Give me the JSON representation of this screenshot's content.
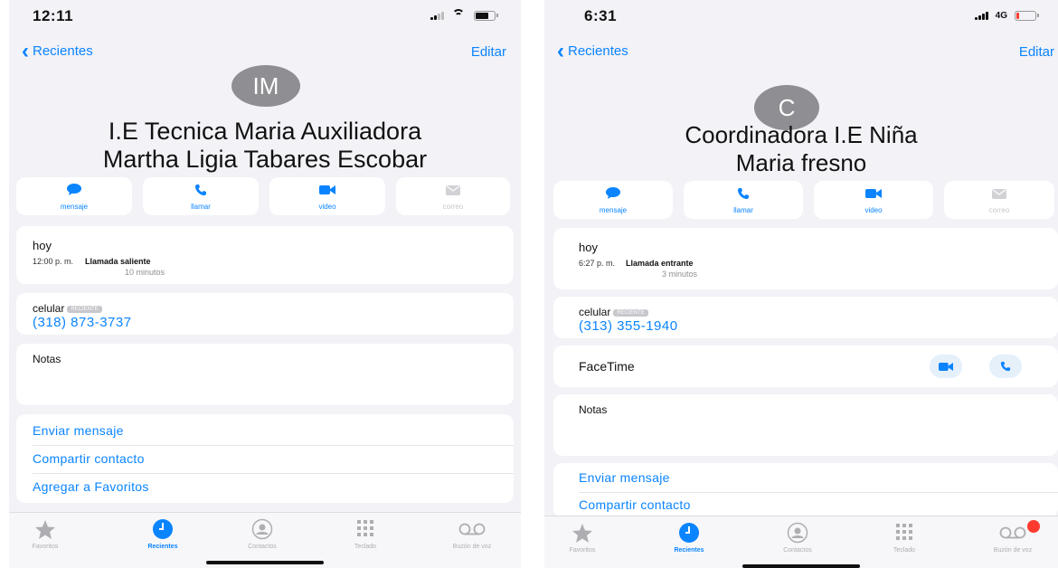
{
  "left": {
    "status": {
      "time": "12:11"
    },
    "nav": {
      "back": "Recientes",
      "edit": "Editar"
    },
    "avatar": "IM",
    "name_lines": [
      "I.E Tecnica Maria Auxiliadora",
      "Martha Ligia Tabares Escobar"
    ],
    "actions": [
      "mensaje",
      "llamar",
      "video",
      "correo"
    ],
    "recent": {
      "day": "hoy",
      "time": "12:00 p. m.",
      "type": "Llamada saliente",
      "duration": "10 minutos"
    },
    "phone": {
      "label": "celular",
      "badge": "RECIENTE",
      "number": "(318) 873-3737"
    },
    "notes_label": "Notas",
    "links": [
      "Enviar mensaje",
      "Compartir contacto",
      "Agregar a Favoritos"
    ],
    "tabs": [
      "Favoritos",
      "Recientes",
      "Contactos",
      "Teclado",
      "Buzón de voz"
    ]
  },
  "right": {
    "status": {
      "time": "6:31",
      "network": "4G"
    },
    "nav": {
      "back": "Recientes",
      "edit": "Editar"
    },
    "avatar": "C",
    "name_lines": [
      "Coordinadora I.E Niña",
      "Maria fresno"
    ],
    "actions": [
      "mensaje",
      "llamar",
      "video",
      "correo"
    ],
    "recent": {
      "day": "hoy",
      "time": "6:27 p. m.",
      "type": "Llamada entrante",
      "duration": "3 minutos"
    },
    "phone": {
      "label": "celular",
      "badge": "RECIENTE",
      "number": "(313) 355-1940"
    },
    "facetime_label": "FaceTime",
    "notes_label": "Notas",
    "links": [
      "Enviar mensaje",
      "Compartir contacto"
    ],
    "tabs": [
      "Favoritos",
      "Recientes",
      "Contactos",
      "Teclado",
      "Buzón de voz"
    ]
  },
  "colors": {
    "accent": "#0a84ff",
    "avatar": "#8e8e93",
    "background": "#f2f2f7",
    "badge": "#ff3b30"
  }
}
